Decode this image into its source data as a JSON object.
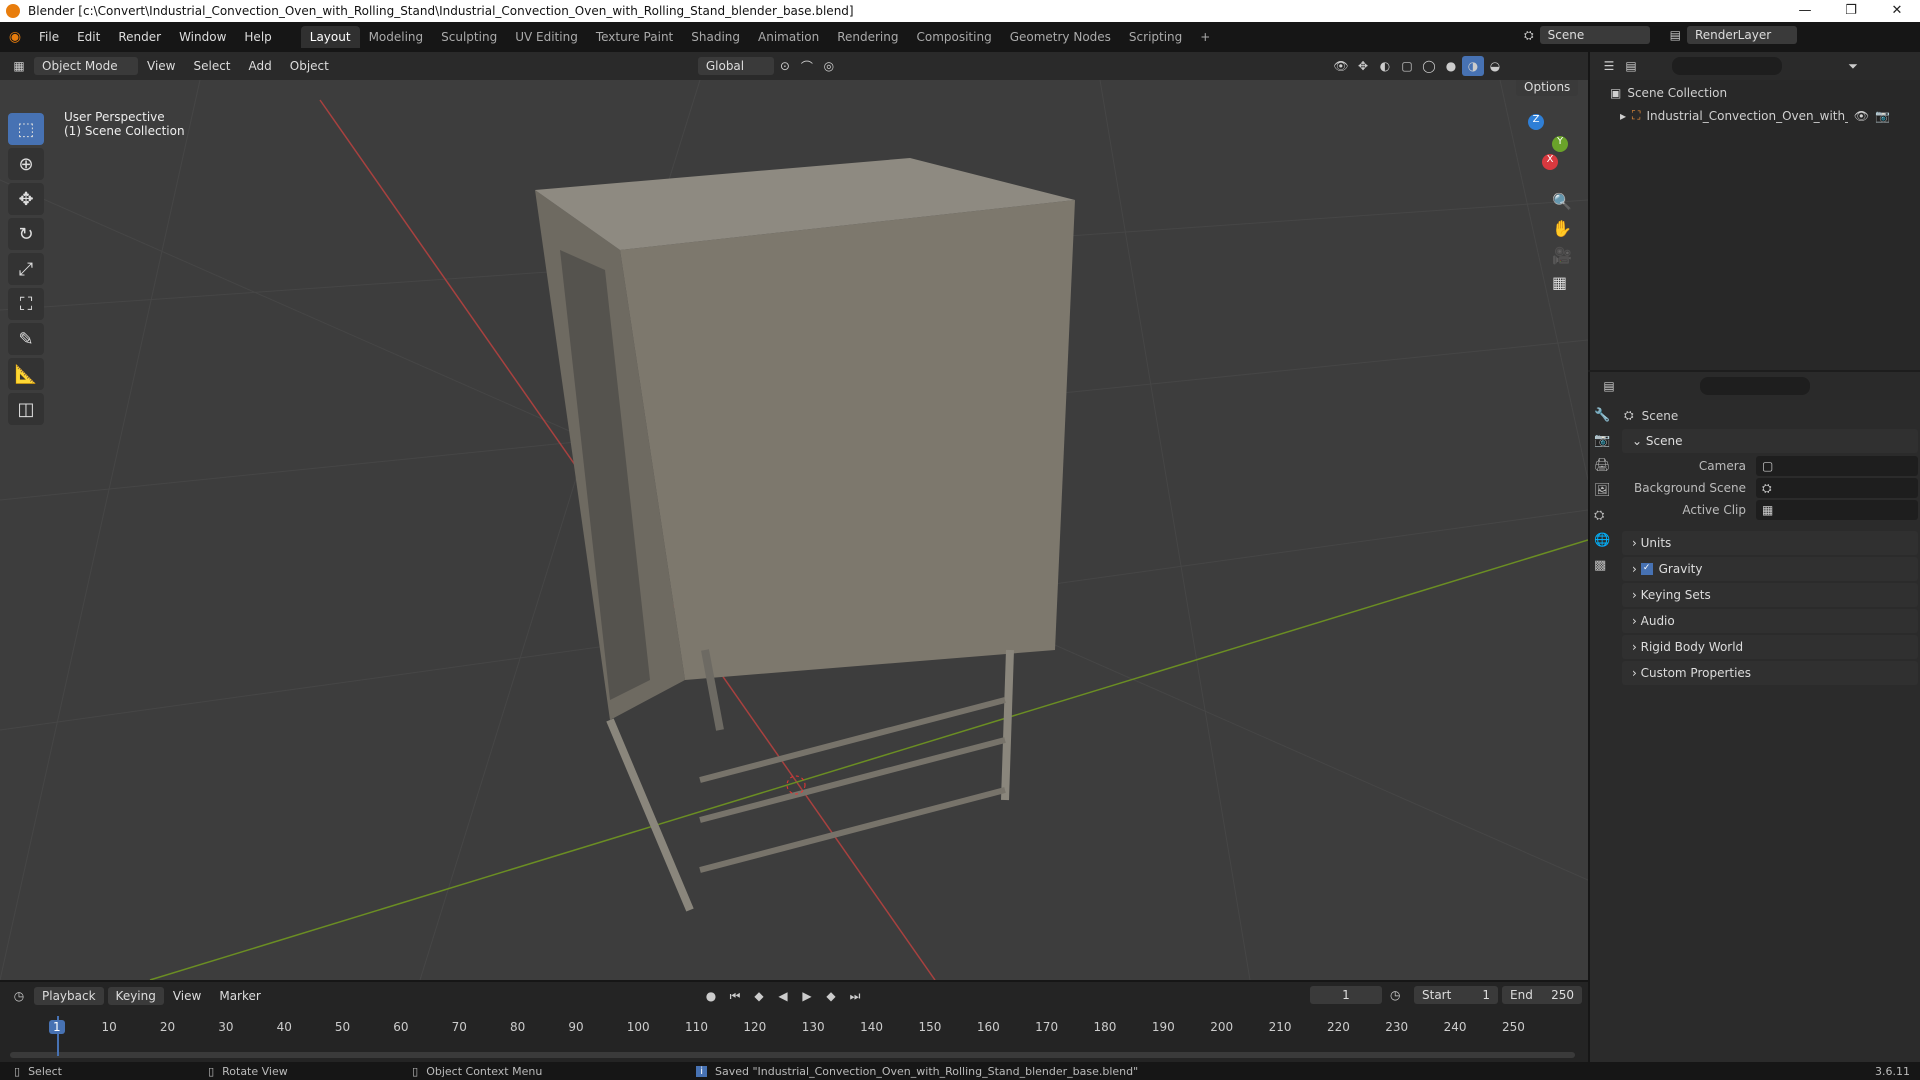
{
  "window": {
    "title": "Blender [c:\\Convert\\Industrial_Convection_Oven_with_Rolling_Stand\\Industrial_Convection_Oven_with_Rolling_Stand_blender_base.blend]",
    "min": "—",
    "max": "❐",
    "close": "✕"
  },
  "menus": [
    "File",
    "Edit",
    "Render",
    "Window",
    "Help"
  ],
  "workspaces": [
    "Layout",
    "Modeling",
    "Sculpting",
    "UV Editing",
    "Texture Paint",
    "Shading",
    "Animation",
    "Rendering",
    "Compositing",
    "Geometry Nodes",
    "Scripting"
  ],
  "add_ws": "+",
  "top_right": {
    "scene": "Scene",
    "renderlayer": "RenderLayer"
  },
  "viewport": {
    "mode": "Object Mode",
    "menus": [
      "View",
      "Select",
      "Add",
      "Object"
    ],
    "transform": "Global",
    "options": "Options",
    "overlay_line1": "User Perspective",
    "overlay_line2": "(1) Scene Collection",
    "gizmo": {
      "x": "X",
      "y": "Y",
      "z": "Z"
    }
  },
  "outliner": {
    "root": "Scene Collection",
    "item": "Industrial_Convection_Oven_with_Rollir"
  },
  "properties": {
    "header": "Scene",
    "panel": "Scene",
    "camera_label": "Camera",
    "bg_label": "Background Scene",
    "clip_label": "Active Clip",
    "sections": [
      "Units",
      "Gravity",
      "Keying Sets",
      "Audio",
      "Rigid Body World",
      "Custom Properties"
    ]
  },
  "timeline": {
    "menus": [
      "Playback",
      "Keying",
      "View",
      "Marker"
    ],
    "current": "1",
    "start_label": "Start",
    "start": "1",
    "end_label": "End",
    "end": "250",
    "ticks": [
      "1",
      "10",
      "20",
      "30",
      "40",
      "50",
      "60",
      "70",
      "80",
      "90",
      "100",
      "110",
      "120",
      "130",
      "140",
      "150",
      "160",
      "170",
      "180",
      "190",
      "200",
      "210",
      "220",
      "230",
      "240",
      "250"
    ]
  },
  "status": {
    "select": "Select",
    "rotate": "Rotate View",
    "context": "Object Context Menu",
    "saved": "Saved \"Industrial_Convection_Oven_with_Rolling_Stand_blender_base.blend\"",
    "version": "3.6.11"
  }
}
